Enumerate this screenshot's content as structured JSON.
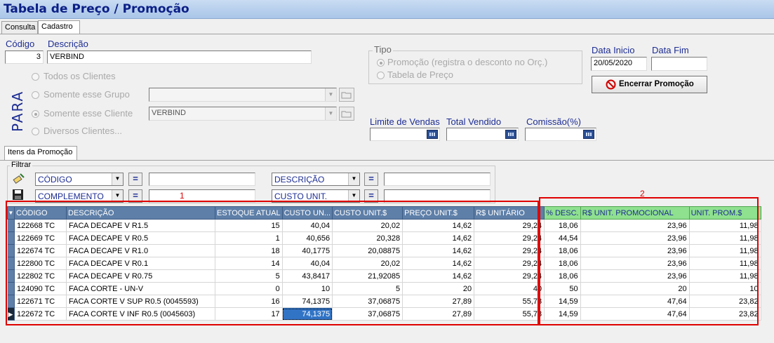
{
  "title": "Tabela de Preço / Promoção",
  "tabs": [
    {
      "label": "Consulta"
    },
    {
      "label": "Cadastro"
    }
  ],
  "form": {
    "codigo_label": "Código",
    "codigo_value": "3",
    "descricao_label": "Descrição",
    "descricao_value": "VERBIND",
    "para_label": "PARA",
    "radios": [
      {
        "label": "Todos os Clientes"
      },
      {
        "label": "Somente esse Grupo"
      },
      {
        "label": "Somente esse Cliente"
      },
      {
        "label": "Diversos Clientes..."
      }
    ],
    "grupo_value": "",
    "cliente_value": "VERBIND",
    "tipo_label": "Tipo",
    "tipo_options": [
      {
        "label": "Promoção (registra o desconto no Orç.)"
      },
      {
        "label": "Tabela de Preço"
      }
    ],
    "data_inicio_label": "Data Inicio",
    "data_inicio_value": "20/05/2020",
    "data_fim_label": "Data Fim",
    "data_fim_value": "",
    "encerrar_label": "Encerrar Promoção",
    "limite_label": "Limite de Vendas",
    "total_label": "Total Vendido",
    "comissao_label": "Comissão(%)"
  },
  "itens_tab": "Itens da Promoção",
  "filtrar": {
    "label": "Filtrar",
    "rows": [
      {
        "field1": "CÓDIGO",
        "value1": "",
        "field2": "DESCRIÇÃO",
        "value2": ""
      },
      {
        "field1": "COMPLEMENTO",
        "value1": "",
        "field2": "CUSTO UNIT.",
        "value2": ""
      }
    ],
    "eq": "="
  },
  "annotations": {
    "box1": "1",
    "box2": "2"
  },
  "grid": {
    "columns": [
      "CÓDIGO",
      "DESCRIÇÃO",
      "ESTOQUE ATUAL",
      "CUSTO UN...",
      "CUSTO UNIT.$",
      "PREÇO UNIT.$",
      "R$ UNITÁRIO",
      "% DESC.",
      "R$ UNIT. PROMOCIONAL",
      "UNIT. PROM.$"
    ],
    "rows": [
      [
        "122668 TC",
        "FACA DECAPE V R1.5",
        "15",
        "40,04",
        "20,02",
        "14,62",
        "29,24",
        "18,06",
        "23,96",
        "11,98"
      ],
      [
        "122669 TC",
        "FACA DECAPE V R0.5",
        "1",
        "40,656",
        "20,328",
        "14,62",
        "29,24",
        "44,54",
        "23,96",
        "11,98"
      ],
      [
        "122674 TC",
        "FACA DECAPE V R1.0",
        "18",
        "40,1775",
        "20,08875",
        "14,62",
        "29,24",
        "18,06",
        "23,96",
        "11,98"
      ],
      [
        "122800 TC",
        "FACA DECAPE V R0.1",
        "14",
        "40,04",
        "20,02",
        "14,62",
        "29,24",
        "18,06",
        "23,96",
        "11,98"
      ],
      [
        "122802 TC",
        "FACA DECAPE V R0.75",
        "5",
        "43,8417",
        "21,92085",
        "14,62",
        "29,24",
        "18,06",
        "23,96",
        "11,98"
      ],
      [
        "124090 TC",
        "FACA CORTE - UN-V",
        "0",
        "10",
        "5",
        "20",
        "40",
        "50",
        "20",
        "10"
      ],
      [
        "122671 TC",
        "FACA CORTE V SUP R0.5  (0045593)",
        "16",
        "74,1375",
        "37,06875",
        "27,89",
        "55,78",
        "14,59",
        "47,64",
        "23,82"
      ],
      [
        "122672 TC",
        "FACA CORTE V INF R0.5    (0045603)",
        "17",
        "74,1375",
        "37,06875",
        "27,89",
        "55,78",
        "14,59",
        "47,64",
        "23,82"
      ]
    ]
  }
}
